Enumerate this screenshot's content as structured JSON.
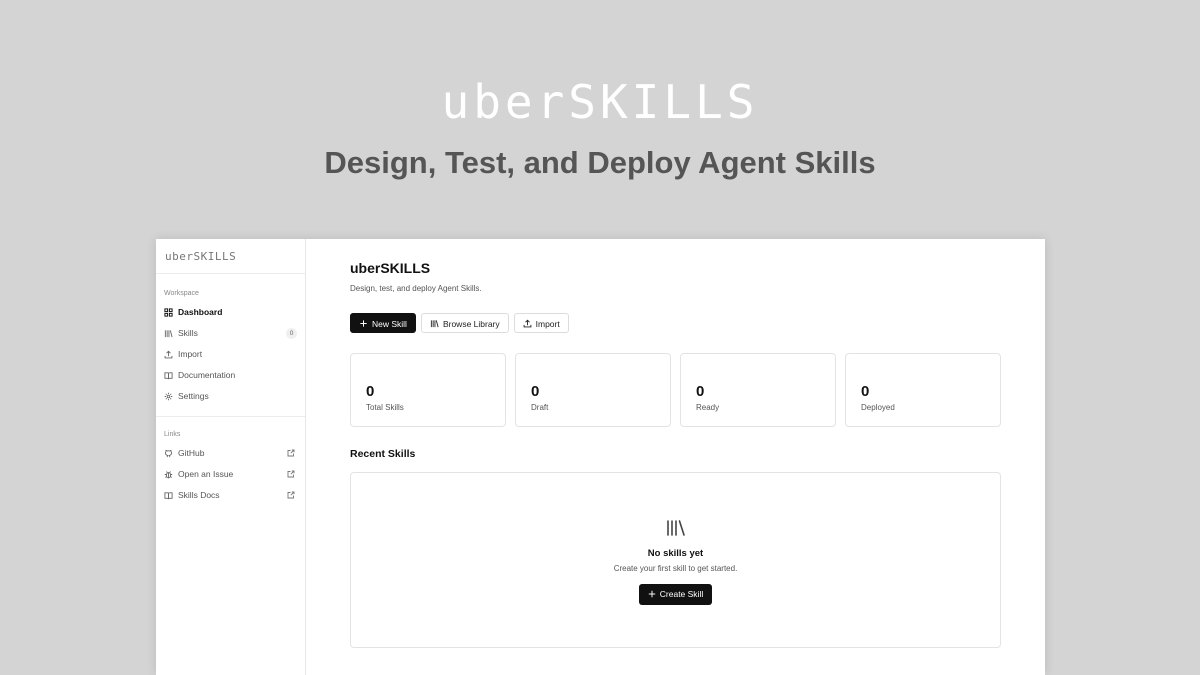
{
  "hero": {
    "logo": "uberSKILLS",
    "tagline": "Design, Test, and Deploy Agent Skills"
  },
  "sidebar": {
    "logo": "uberSKILLS",
    "workspace_label": "Workspace",
    "items": [
      {
        "label": "Dashboard",
        "icon": "grid-icon"
      },
      {
        "label": "Skills",
        "icon": "library-icon",
        "badge": "0"
      },
      {
        "label": "Import",
        "icon": "upload-icon"
      },
      {
        "label": "Documentation",
        "icon": "book-icon"
      },
      {
        "label": "Settings",
        "icon": "gear-icon"
      }
    ],
    "links_label": "Links",
    "links": [
      {
        "label": "GitHub",
        "icon": "github-icon"
      },
      {
        "label": "Open an Issue",
        "icon": "bug-icon"
      },
      {
        "label": "Skills Docs",
        "icon": "book-icon"
      }
    ]
  },
  "main": {
    "title": "uberSKILLS",
    "subtitle": "Design, test, and deploy Agent Skills.",
    "actions": {
      "new_skill": "New Skill",
      "browse_library": "Browse Library",
      "import": "Import"
    },
    "stats": [
      {
        "value": "0",
        "label": "Total Skills"
      },
      {
        "value": "0",
        "label": "Draft"
      },
      {
        "value": "0",
        "label": "Ready"
      },
      {
        "value": "0",
        "label": "Deployed"
      }
    ],
    "recent": {
      "title": "Recent Skills",
      "empty_title": "No skills yet",
      "empty_subtitle": "Create your first skill to get started.",
      "create_button": "Create Skill"
    }
  },
  "colors": {
    "background": "#d4d4d4",
    "primary_button": "#111111",
    "tagline": "#555555"
  }
}
